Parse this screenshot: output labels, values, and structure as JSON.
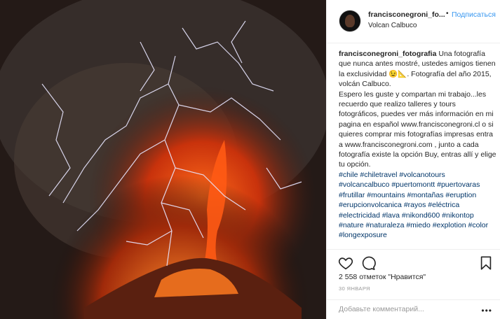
{
  "post": {
    "image_alt": "Volcan Calbuco eruption with lightning",
    "colors": {
      "link": "#003569",
      "follow": "#3897f0",
      "muted": "#999999"
    }
  },
  "header": {
    "username": "francisconegroni_fo...",
    "dot": "•",
    "follow_label": "Подписаться",
    "location": "Volcan Calbuco"
  },
  "caption": {
    "username": "francisconegroni_fotografia",
    "text": " Una fotografía que nunca antes mostré, ustedes amigos tienen la exclusividad 😉📐. Fotografía del año 2015, volcán Calbuco.\nEspero les guste y compartan mi trabajo...les recuerdo que realizo talleres y tours fotográficos, puedes ver más información en mi pagina en español www.francisconegroni.cl o si quieres comprar mis fotografías impresas entra a www.francisconegroni.com , junto a cada fotografía existe la opción Buy, entras allí y elige tu opción.",
    "hashtags": [
      "#chile",
      "#chiletravel",
      "#volcanotours",
      "#volcancalbuco",
      "#puertomontt",
      "#puertovaras",
      "#frutillar",
      "#mountains",
      "#montañas",
      "#eruption",
      "#erupcionvolcanica",
      "#rayos",
      "#eléctrica",
      "#electricidad",
      "#lava",
      "#nikond600",
      "#nikontop",
      "#nature",
      "#naturaleza",
      "#miedo",
      "#explotion",
      "#color",
      "#longexposure"
    ]
  },
  "actions": {
    "like_icon": "heart-icon",
    "comment_icon": "comment-icon",
    "save_icon": "bookmark-icon",
    "likes_text": "2 558 отметок \"Нравится\"",
    "date": "30 ЯНВАРЯ",
    "comment_placeholder": "Добавьте комментарий...",
    "more": "•••"
  }
}
